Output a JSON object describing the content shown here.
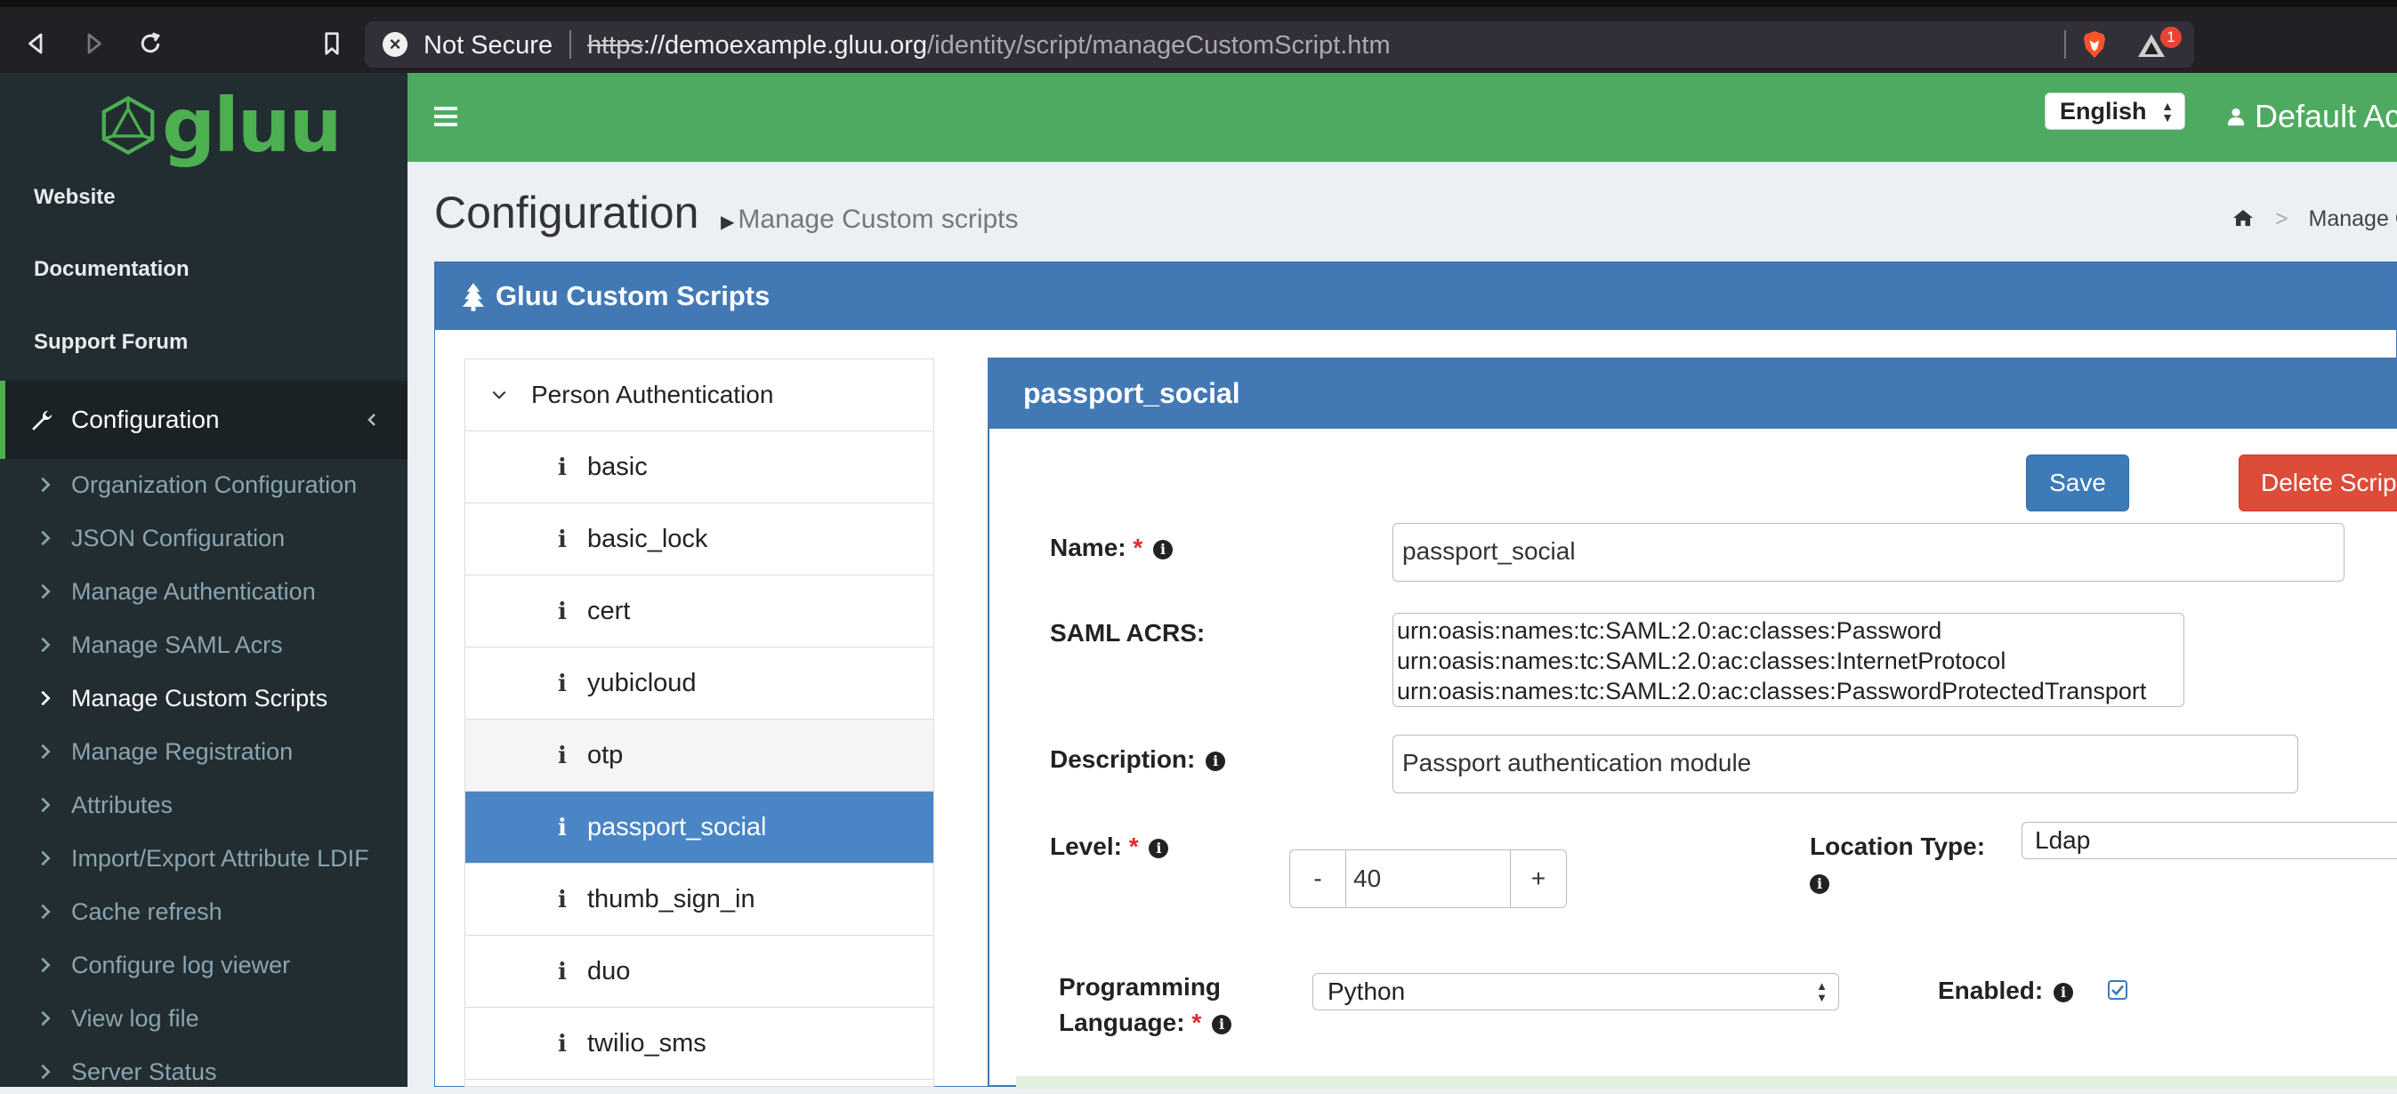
{
  "browser": {
    "security_label": "Not Secure",
    "url_scheme": "https",
    "url_host": "://demoexample.gluu.org",
    "url_path": "/identity/script/manageCustomScript.htm",
    "rewards_badge": "1",
    "icons": [
      "back-icon",
      "forward-icon",
      "reload-icon",
      "bookmark-icon",
      "brave-shield-icon",
      "brave-rewards-icon"
    ]
  },
  "sidebar": {
    "logo_text": "gluu",
    "links": [
      "Website",
      "Documentation",
      "Support Forum"
    ],
    "section_label": "Configuration",
    "items": [
      {
        "label": "Organization Configuration"
      },
      {
        "label": "JSON Configuration"
      },
      {
        "label": "Manage Authentication"
      },
      {
        "label": "Manage SAML Acrs"
      },
      {
        "label": "Manage Custom Scripts"
      },
      {
        "label": "Manage Registration"
      },
      {
        "label": "Attributes"
      },
      {
        "label": "Import/Export Attribute LDIF"
      },
      {
        "label": "Cache refresh"
      },
      {
        "label": "Configure log viewer"
      },
      {
        "label": "View log file"
      },
      {
        "label": "Server Status"
      }
    ],
    "active_item": "Manage Custom Scripts"
  },
  "header": {
    "language": "English",
    "user_label": "Default Ac"
  },
  "page": {
    "title": "Configuration",
    "subtitle": "Manage Custom scripts",
    "breadcrumb": "Manage C"
  },
  "panel": {
    "title": "Gluu Custom Scripts"
  },
  "script_list": {
    "group": "Person Authentication",
    "items": [
      "basic",
      "basic_lock",
      "cert",
      "yubicloud",
      "otp",
      "passport_social",
      "thumb_sign_in",
      "duo",
      "twilio_sms"
    ],
    "selected": "passport_social",
    "hovered": "otp",
    "info_glyph": "i"
  },
  "detail": {
    "title": "passport_social",
    "save_label": "Save",
    "delete_label": "Delete Script",
    "name_label": "Name:",
    "name_value": "passport_social",
    "acrs_label": "SAML ACRS:",
    "acrs_values": [
      "urn:oasis:names:tc:SAML:2.0:ac:classes:Password",
      "urn:oasis:names:tc:SAML:2.0:ac:classes:InternetProtocol",
      "urn:oasis:names:tc:SAML:2.0:ac:classes:PasswordProtectedTransport"
    ],
    "description_label": "Description:",
    "description_value": "Passport authentication module",
    "level_label": "Level:",
    "level_value": "40",
    "level_minus": "-",
    "level_plus": "+",
    "location_label": "Location Type:",
    "location_value": "Ldap",
    "programming_label_line1": "Programming",
    "programming_label_line2": "Language:",
    "programming_value": "Python",
    "enabled_label": "Enabled:",
    "enabled": true,
    "required_mark": "*",
    "info_glyph": "i"
  },
  "colors": {
    "sidebar_bg": "#222d32",
    "header_green": "#4eaa60",
    "panel_blue": "#4279b5",
    "selected_row": "#4a85c6",
    "danger": "#dd4b39"
  }
}
